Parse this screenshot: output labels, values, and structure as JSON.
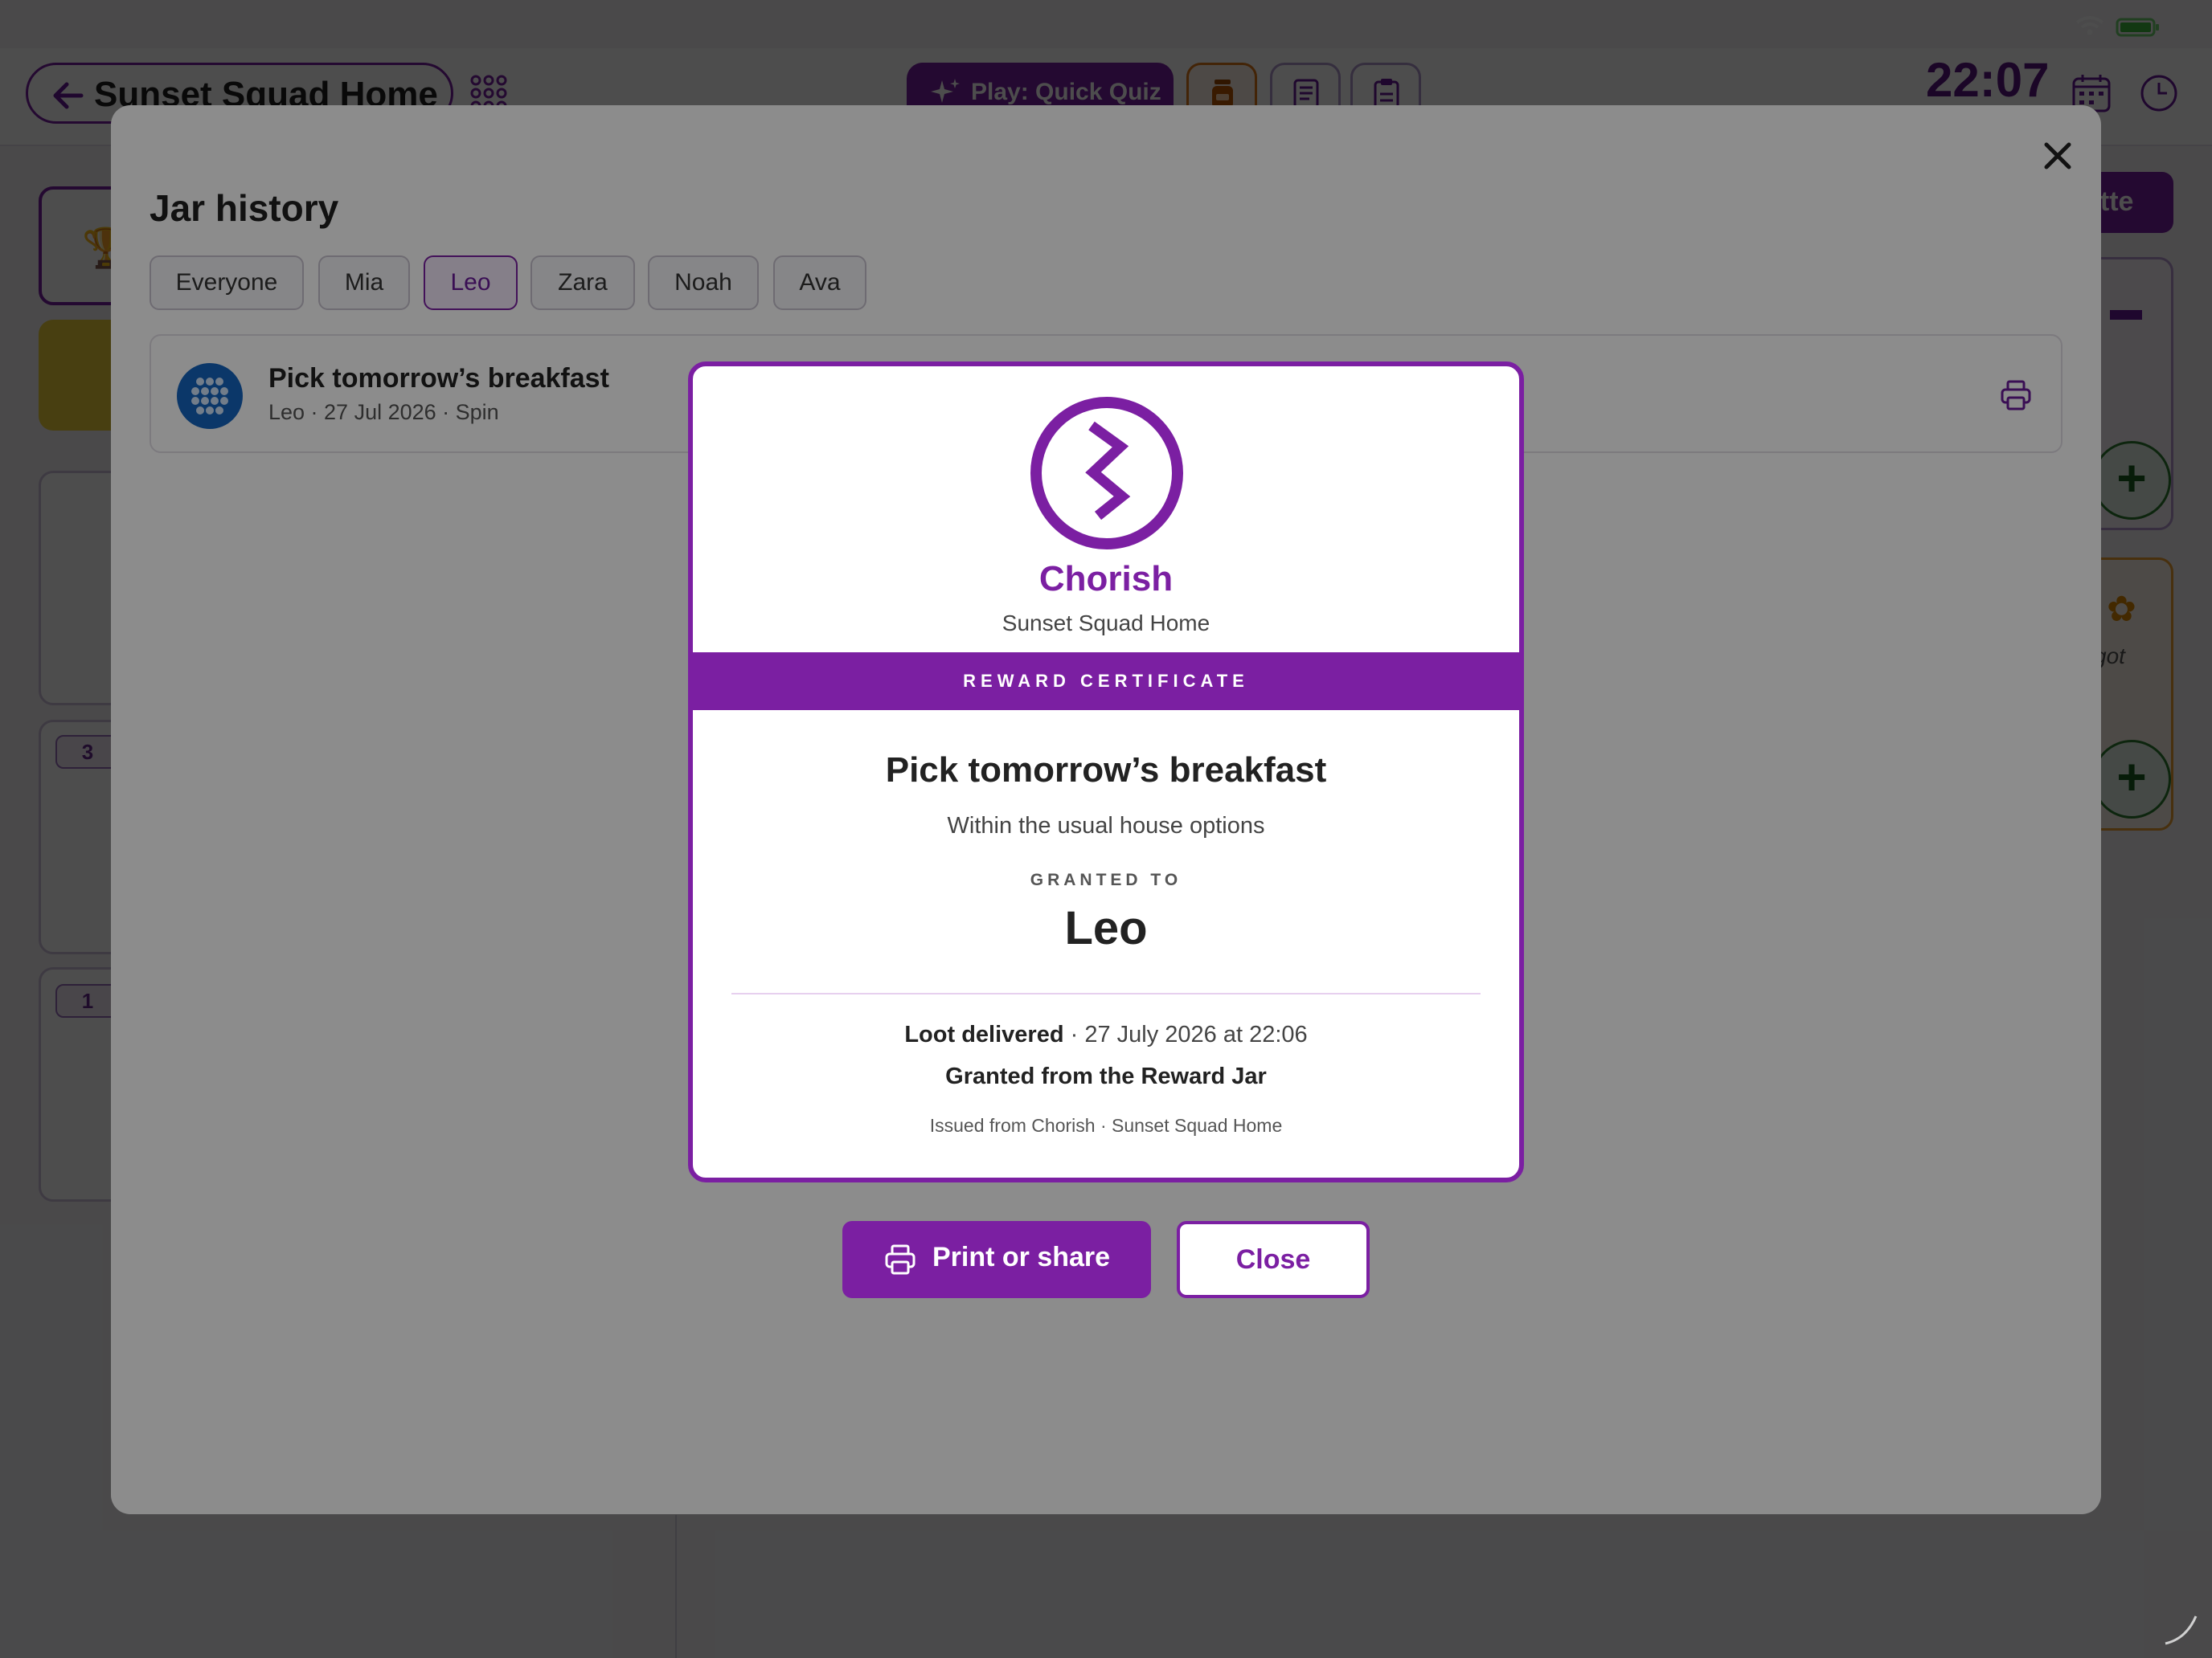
{
  "app": {
    "home_title": "Sunset Squad Home",
    "play_button": "Play: Quick Quiz",
    "clock": "22:07",
    "side_numbers": [
      "3",
      "1"
    ],
    "right_partial_button": "ette",
    "right_partial_text": "got"
  },
  "history": {
    "title": "Jar history",
    "filters": [
      "Everyone",
      "Mia",
      "Leo",
      "Zara",
      "Noah",
      "Ava"
    ],
    "active_filter": "Leo",
    "entries": [
      {
        "title": "Pick tomorrow’s breakfast",
        "meta": "Leo · 27 Jul 2026 · Spin"
      }
    ]
  },
  "certificate": {
    "brand": "Chorish",
    "home": "Sunset Squad Home",
    "band": "REWARD CERTIFICATE",
    "reward_title": "Pick tomorrow’s breakfast",
    "reward_desc": "Within the usual house options",
    "granted_label": "GRANTED TO",
    "granted_name": "Leo",
    "loot_label": "Loot delivered",
    "loot_detail": " · 27 July 2026 at 22:06",
    "source": "Granted from the Reward Jar",
    "issued": "Issued from Chorish · Sunset Squad Home"
  },
  "actions": {
    "print_label": "Print or share",
    "close_label": "Close"
  },
  "colors": {
    "accent": "#7b1fa2",
    "avatar": "#1565c0"
  }
}
